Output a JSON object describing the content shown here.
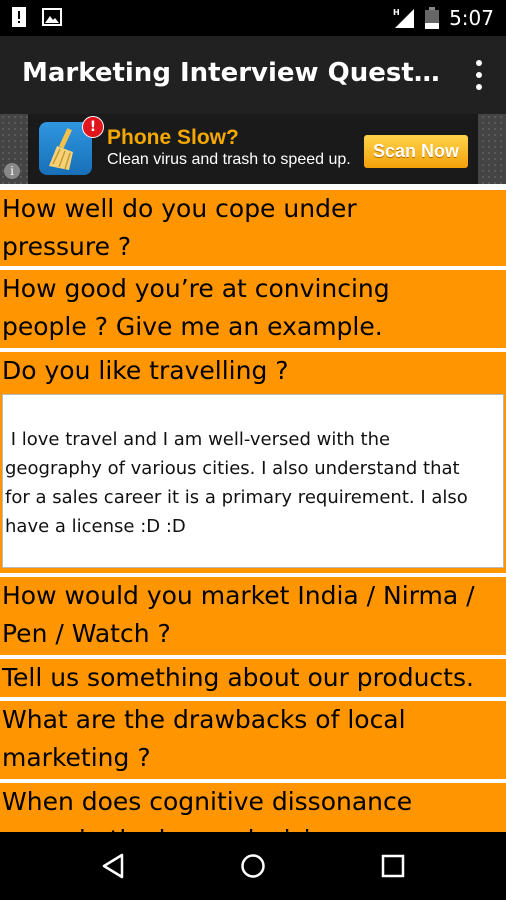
{
  "status_bar": {
    "time": "5:07",
    "icons": [
      "alert-icon",
      "image-icon",
      "signal-icon",
      "battery-icon"
    ]
  },
  "app_bar": {
    "title": "Marketing Interview Question & Answer",
    "overflow_icon": "more-vertical-icon"
  },
  "ad": {
    "badge": "!",
    "headline": "Phone Slow?",
    "subtext": "Clean virus and trash to speed up.",
    "button": "Scan Now",
    "info": "i",
    "colors": {
      "headline": "#f4a800",
      "button": "#f3a10a"
    }
  },
  "list": {
    "item_color": "#ff9500",
    "q1": {
      "line1": "How well do you cope under",
      "line2": "pressure ?"
    },
    "q2": {
      "line1": "How good you’re at convincing",
      "line2": "people ? Give me an example."
    },
    "q3": {
      "line1": "Do you like travelling ?"
    },
    "answer": " I love travel and I am well-versed with the\ngeography of various cities. I also understand that\nfor a sales career it is a primary requirement. I also\nhave a license :D :D",
    "q4": {
      "line1": "How would you market India / Nirma /",
      "line2": "Pen / Watch ?"
    },
    "q5": {
      "line1": "Tell us something about our products."
    },
    "q6": {
      "line1": "What are the drawbacks of local",
      "line2": "marketing ?"
    },
    "q7": {
      "line1": "When does cognitive dissonance",
      "line2": "occur in the buyer decision"
    }
  },
  "nav_bar": {
    "icons": [
      "back-icon",
      "home-icon",
      "recents-icon"
    ]
  }
}
